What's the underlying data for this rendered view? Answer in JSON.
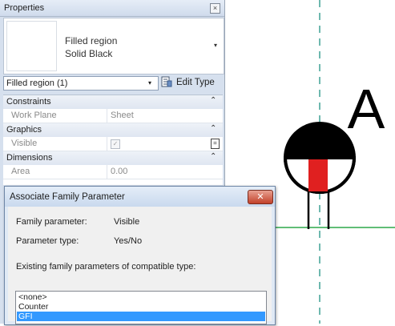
{
  "properties_panel": {
    "title": "Properties",
    "close_glyph": "×",
    "type_selector": {
      "family": "Filled region",
      "type": "Solid Black",
      "arrow": "▾"
    },
    "instance_filter": {
      "value": "Filled region (1)",
      "arrow": "▾"
    },
    "edit_type_label": "Edit Type",
    "groups": [
      {
        "label": "Constraints",
        "chevron": "⌃"
      },
      {
        "label": "Graphics",
        "chevron": "⌃"
      },
      {
        "label": "Dimensions",
        "chevron": "⌃"
      }
    ],
    "rows": {
      "work_plane": {
        "key": "Work Plane",
        "value": "Sheet"
      },
      "visible": {
        "key": "Visible",
        "checked": true,
        "check_glyph": "✓",
        "assoc_glyph": "="
      },
      "area": {
        "key": "Area",
        "value": "0.00"
      }
    }
  },
  "canvas": {
    "label_text": "A",
    "colors": {
      "reference_line": "#0f8a7a",
      "level_line": "#2da84a",
      "symbol_fill": "#000000",
      "symbol_red": "#e02020"
    }
  },
  "dialog": {
    "title": "Associate Family Parameter",
    "close_glyph": "✕",
    "family_parameter_label": "Family parameter:",
    "family_parameter_value": "Visible",
    "parameter_type_label": "Parameter type:",
    "parameter_type_value": "Yes/No",
    "existing_label": "Existing family parameters of compatible type:",
    "options": [
      "<none>",
      "Counter",
      "GFI"
    ],
    "selected_option": "GFI"
  }
}
